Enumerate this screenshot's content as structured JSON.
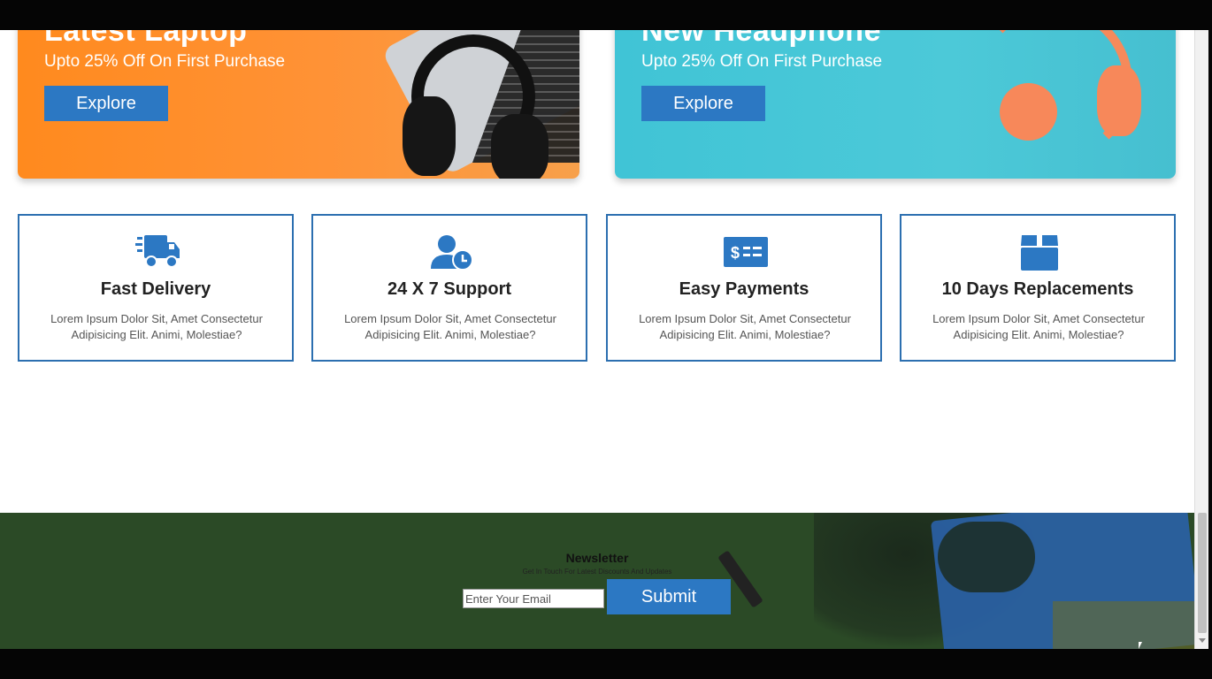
{
  "banners": [
    {
      "title": "Latest Laptop",
      "subtitle": "Upto 25% Off On First Purchase",
      "button": "Explore",
      "color": "#ff8a1e"
    },
    {
      "title": "New Headphone",
      "subtitle": "Upto 25% Off On First Purchase",
      "button": "Explore",
      "color": "#40c4d6"
    }
  ],
  "features": [
    {
      "icon": "delivery-truck-icon",
      "title": "Fast Delivery",
      "desc": "Lorem Ipsum Dolor Sit, Amet Consectetur Adipisicing Elit. Animi, Molestiae?"
    },
    {
      "icon": "user-clock-icon",
      "title": "24 X 7 Support",
      "desc": "Lorem Ipsum Dolor Sit, Amet Consectetur Adipisicing Elit. Animi, Molestiae?"
    },
    {
      "icon": "money-check-icon",
      "title": "Easy Payments",
      "desc": "Lorem Ipsum Dolor Sit, Amet Consectetur Adipisicing Elit. Animi, Molestiae?"
    },
    {
      "icon": "box-icon",
      "title": "10 Days Replacements",
      "desc": "Lorem Ipsum Dolor Sit, Amet Consectetur Adipisicing Elit. Animi, Molestiae?"
    }
  ],
  "newsletter": {
    "title": "Newsletter",
    "subtitle": "Get In Touch For Latest Discounts And Updates",
    "placeholder": "Enter Your Email",
    "button": "Submit"
  },
  "colors": {
    "accent": "#2c78c3",
    "border": "#2c6fb0",
    "footer": "#2b4a26"
  }
}
